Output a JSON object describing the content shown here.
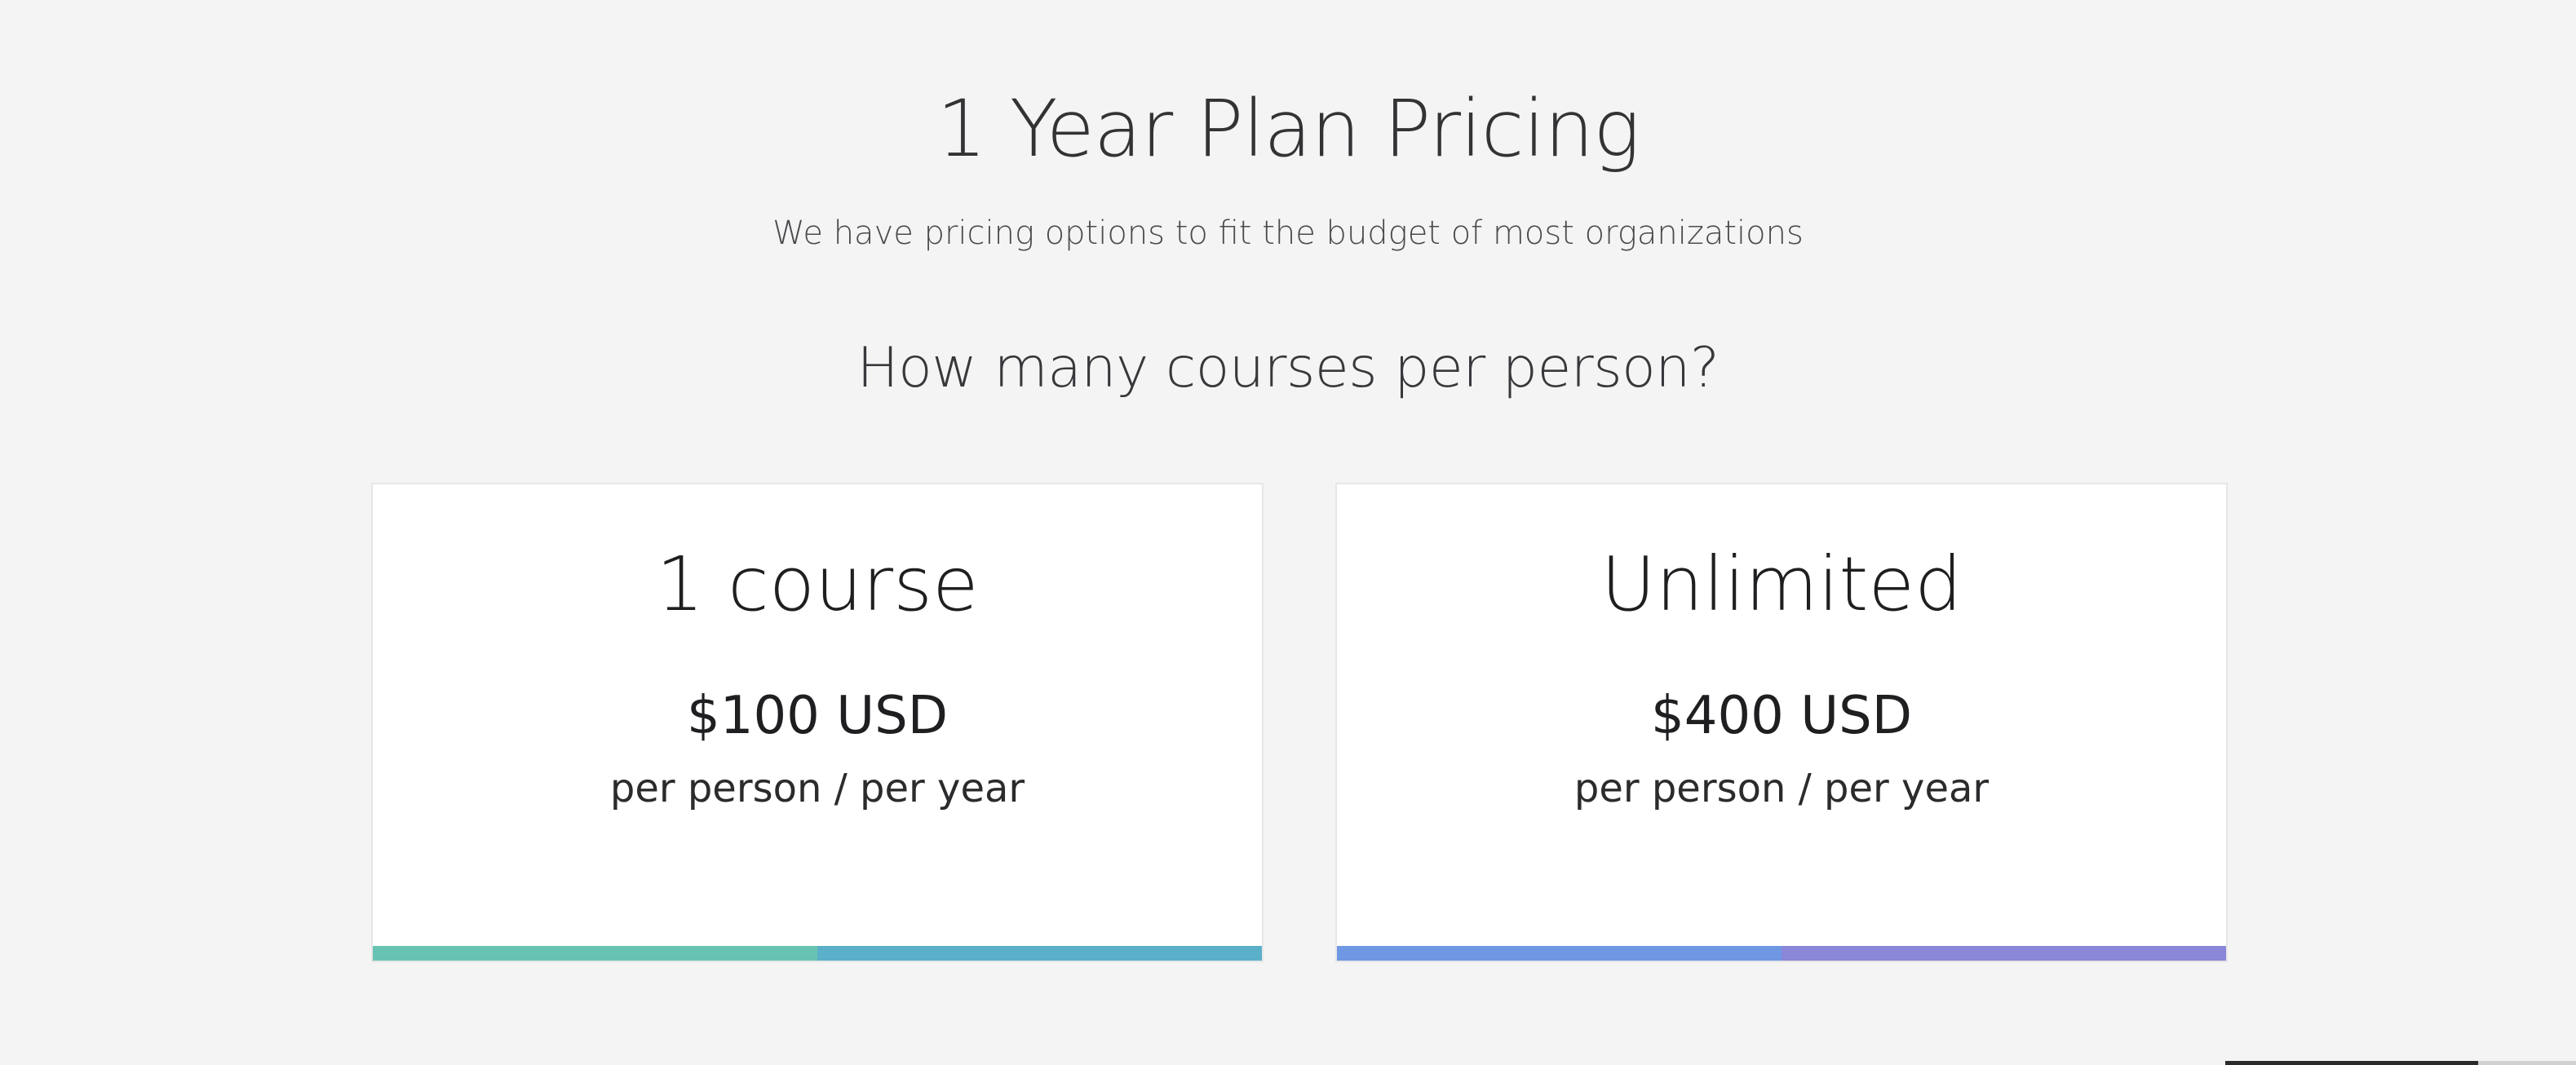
{
  "header": {
    "title": "1 Year Plan Pricing",
    "subtitle": "We have pricing options to fit the budget of most organizations",
    "question": "How many courses per person?"
  },
  "plans": [
    {
      "name": "1 course",
      "price": "$100 USD",
      "unit": "per person / per year",
      "bar_colors": [
        "#68c3b3",
        "#5bb0c9"
      ]
    },
    {
      "name": "Unlimited",
      "price": "$400 USD",
      "unit": "per person / per year",
      "bar_colors": [
        "#6f97e3",
        "#8a86d8"
      ]
    }
  ],
  "colors": {
    "background": "#f4f4f4",
    "card": "#ffffff",
    "text": "#333336"
  }
}
